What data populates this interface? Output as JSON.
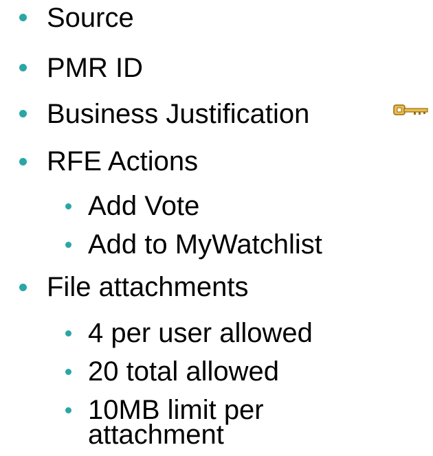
{
  "colors": {
    "bullet": "#2aa6a6",
    "text": "#000000",
    "key_fill": "#e7bd4f",
    "key_stroke": "#9a6a10"
  },
  "icons": {
    "business_justification": "key-icon"
  },
  "items": [
    {
      "label": "Source"
    },
    {
      "label": "PMR ID"
    },
    {
      "label": "Business Justification"
    },
    {
      "label": "RFE Actions"
    },
    {
      "label": "Add Vote"
    },
    {
      "label": "Add to MyWatchlist"
    },
    {
      "label": "File attachments"
    },
    {
      "label": "4 per user allowed"
    },
    {
      "label": "20 total allowed"
    },
    {
      "label": "10MB limit per"
    },
    {
      "label": "attachment"
    }
  ]
}
